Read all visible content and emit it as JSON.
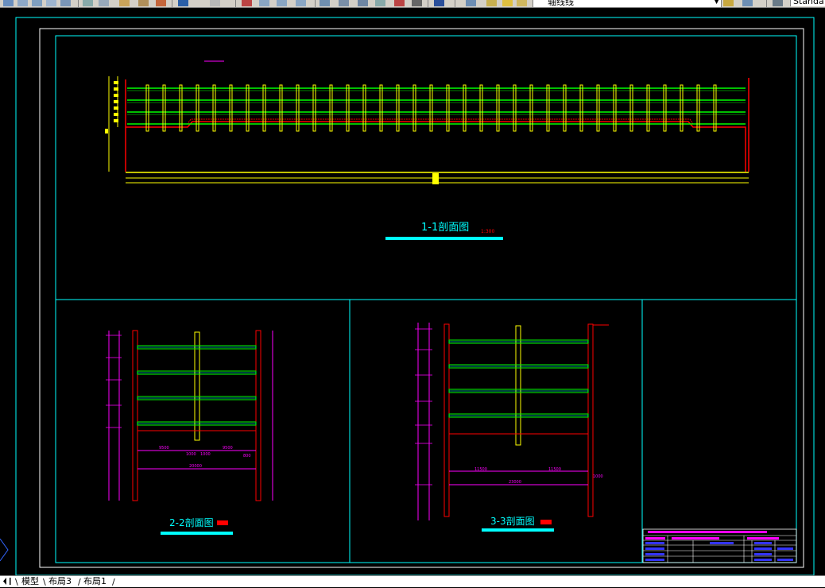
{
  "toolbar": {
    "layer_name": "轴线线",
    "text_style": "Standa"
  },
  "drawing": {
    "section_1_title": "1-1剖面图",
    "section_1_scale": "1:300",
    "section_2_title": "2-2剖面图",
    "section_3_title": "3-3剖面图",
    "dims_2_2": {
      "left_half": "9500",
      "right_half": "9500",
      "total": "20000",
      "center_a": "1000",
      "center_b": "1000",
      "right_small": "800"
    },
    "dims_3_3": {
      "left_half": "11500",
      "right_half": "11500",
      "total": "23000",
      "right_small": "1000"
    }
  },
  "tabs": [
    "模型",
    "布局3",
    "布局1"
  ],
  "colors": {
    "frame": "#00ffff",
    "wall": "#ff0000",
    "strut": "#00ff00",
    "pile": "#ffff00",
    "dimension": "#ff00ff",
    "title_text": "#00ffff"
  }
}
